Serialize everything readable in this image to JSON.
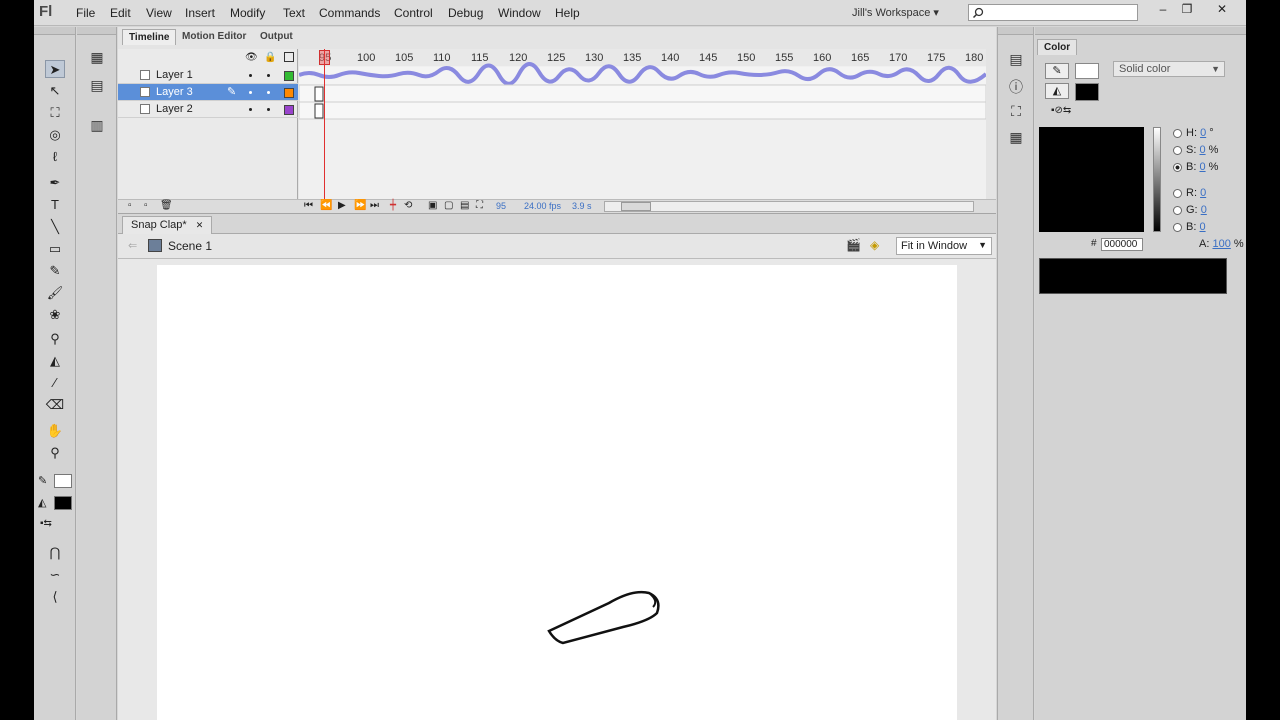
{
  "app": {
    "logo": "Fl"
  },
  "menu": [
    "File",
    "Edit",
    "View",
    "Insert",
    "Modify",
    "Text",
    "Commands",
    "Control",
    "Debug",
    "Window",
    "Help"
  ],
  "workspace": "Jill's Workspace",
  "window_controls": [
    "–",
    "❐",
    "✕"
  ],
  "timeline": {
    "tabs": [
      "Timeline",
      "Motion Editor",
      "Output"
    ],
    "frame_numbers": [
      "95",
      "100",
      "105",
      "110",
      "115",
      "120",
      "125",
      "130",
      "135",
      "140",
      "145",
      "150",
      "155",
      "160",
      "165",
      "170",
      "175",
      "180"
    ],
    "layers": [
      {
        "name": "Layer 1",
        "color": "#33bb33",
        "selected": false
      },
      {
        "name": "Layer 3",
        "color": "#ff8800",
        "selected": true
      },
      {
        "name": "Layer 2",
        "color": "#9944cc",
        "selected": false
      }
    ],
    "footer": {
      "frame": "95",
      "fps": "24.00 fps",
      "time": "3.9 s"
    }
  },
  "document": {
    "tab": "Snap Clap*",
    "close": "✕",
    "scene": "Scene 1",
    "zoom": "Fit in Window"
  },
  "color_panel": {
    "title": "Color",
    "fill_type": "Solid color",
    "hex": "000000",
    "hex_label": "#",
    "hsb": [
      {
        "label": "H:",
        "value": "0",
        "unit": "°"
      },
      {
        "label": "S:",
        "value": "0",
        "unit": "%"
      },
      {
        "label": "B:",
        "value": "0",
        "unit": "%"
      }
    ],
    "rgb": [
      {
        "label": "R:",
        "value": "0"
      },
      {
        "label": "G:",
        "value": "0"
      },
      {
        "label": "B:",
        "value": "0"
      }
    ],
    "alpha": {
      "label": "A:",
      "value": "100",
      "unit": "%"
    },
    "current_color": "#000000"
  }
}
